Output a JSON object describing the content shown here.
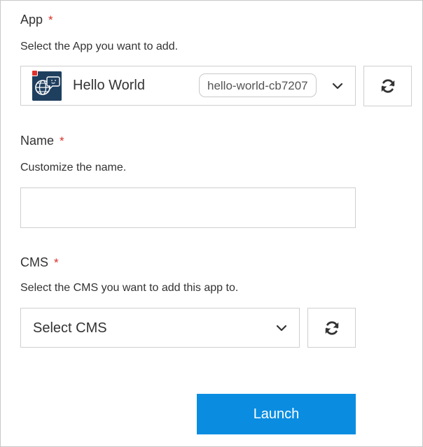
{
  "app_field": {
    "label": "App",
    "required_mark": "*",
    "help": "Select the App you want to add.",
    "selected": {
      "name": "Hello World",
      "slug": "hello-world-cb7207",
      "icon": "globe-chat-app-icon"
    },
    "dropdown_icon": "chevron-down-icon",
    "refresh_icon": "refresh-icon"
  },
  "name_field": {
    "label": "Name",
    "required_mark": "*",
    "help": "Customize the name.",
    "value": "",
    "placeholder": ""
  },
  "cms_field": {
    "label": "CMS",
    "required_mark": "*",
    "help": "Select the CMS you want to add this app to.",
    "selected": "Select CMS",
    "dropdown_icon": "chevron-down-icon",
    "refresh_icon": "refresh-icon"
  },
  "actions": {
    "launch_label": "Launch"
  },
  "colors": {
    "required": "#d93025",
    "primary": "#0a8de1",
    "border": "#cfcfcf"
  }
}
